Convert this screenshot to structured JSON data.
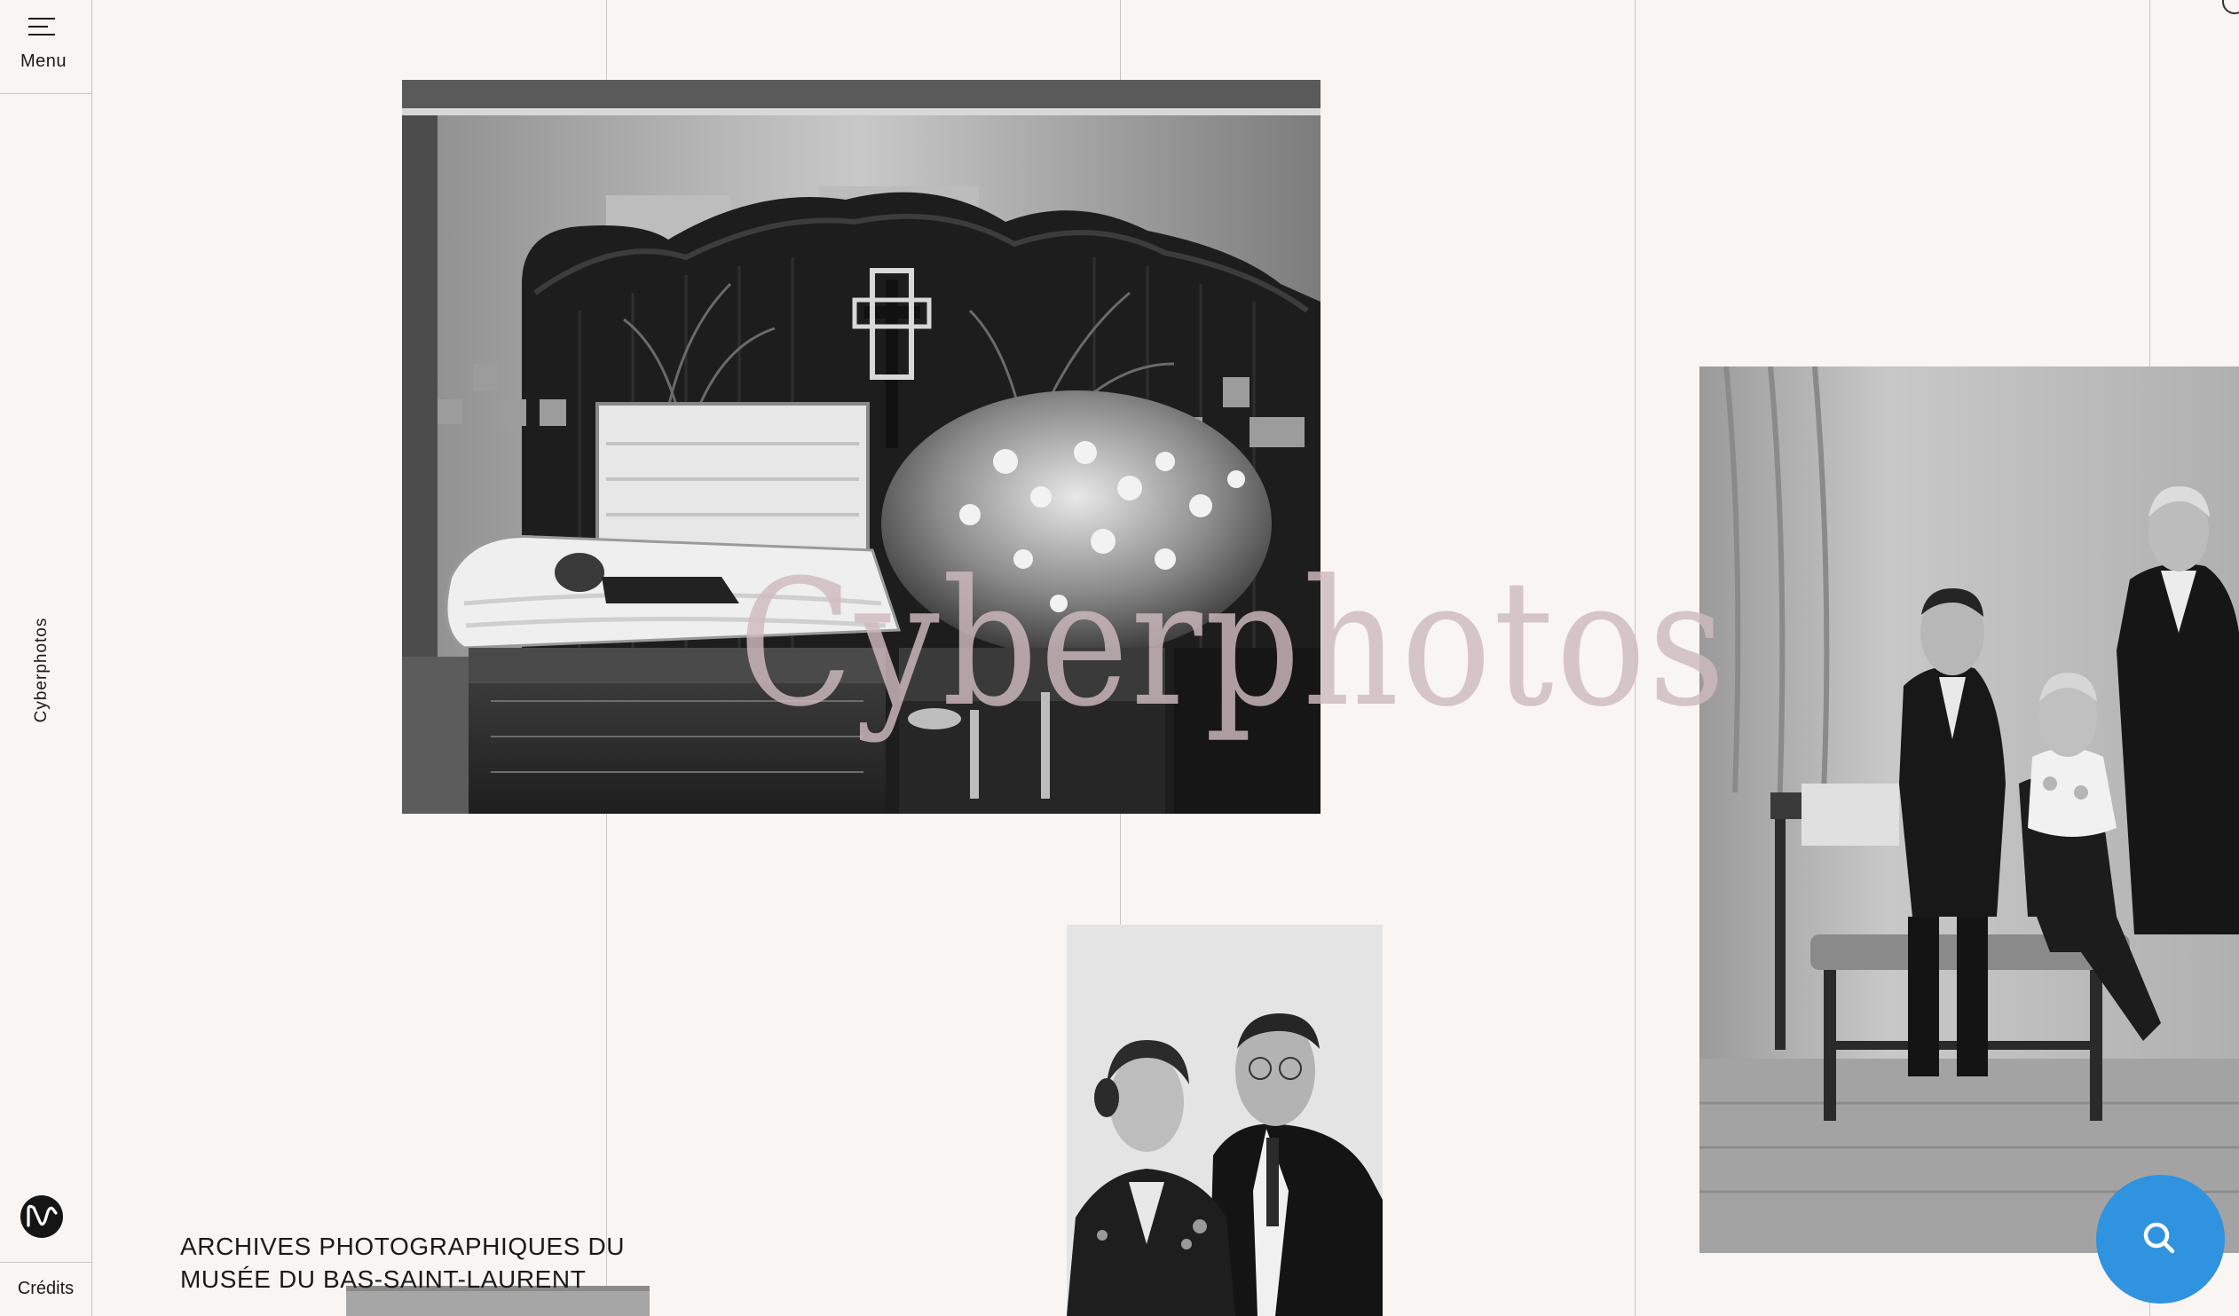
{
  "sidebar": {
    "menu_label": "Menu",
    "menu_icon": "hamburger-menu-icon",
    "vertical_label": "Cyberphotos",
    "logo_icon": "museum-logo-icon",
    "credits_label": "Crédits"
  },
  "hero": {
    "title": "Cyberphotos"
  },
  "archive": {
    "line1": "ARCHIVES PHOTOGRAPHIQUES DU",
    "line2": "MUSÉE DU BAS-SAINT-LAURENT"
  },
  "search": {
    "icon": "search-icon",
    "button_color": "#2f93df"
  },
  "colors": {
    "background": "#f9f5f2",
    "grid_line": "#c9c5c2",
    "title_tint": "#cebbbe"
  }
}
